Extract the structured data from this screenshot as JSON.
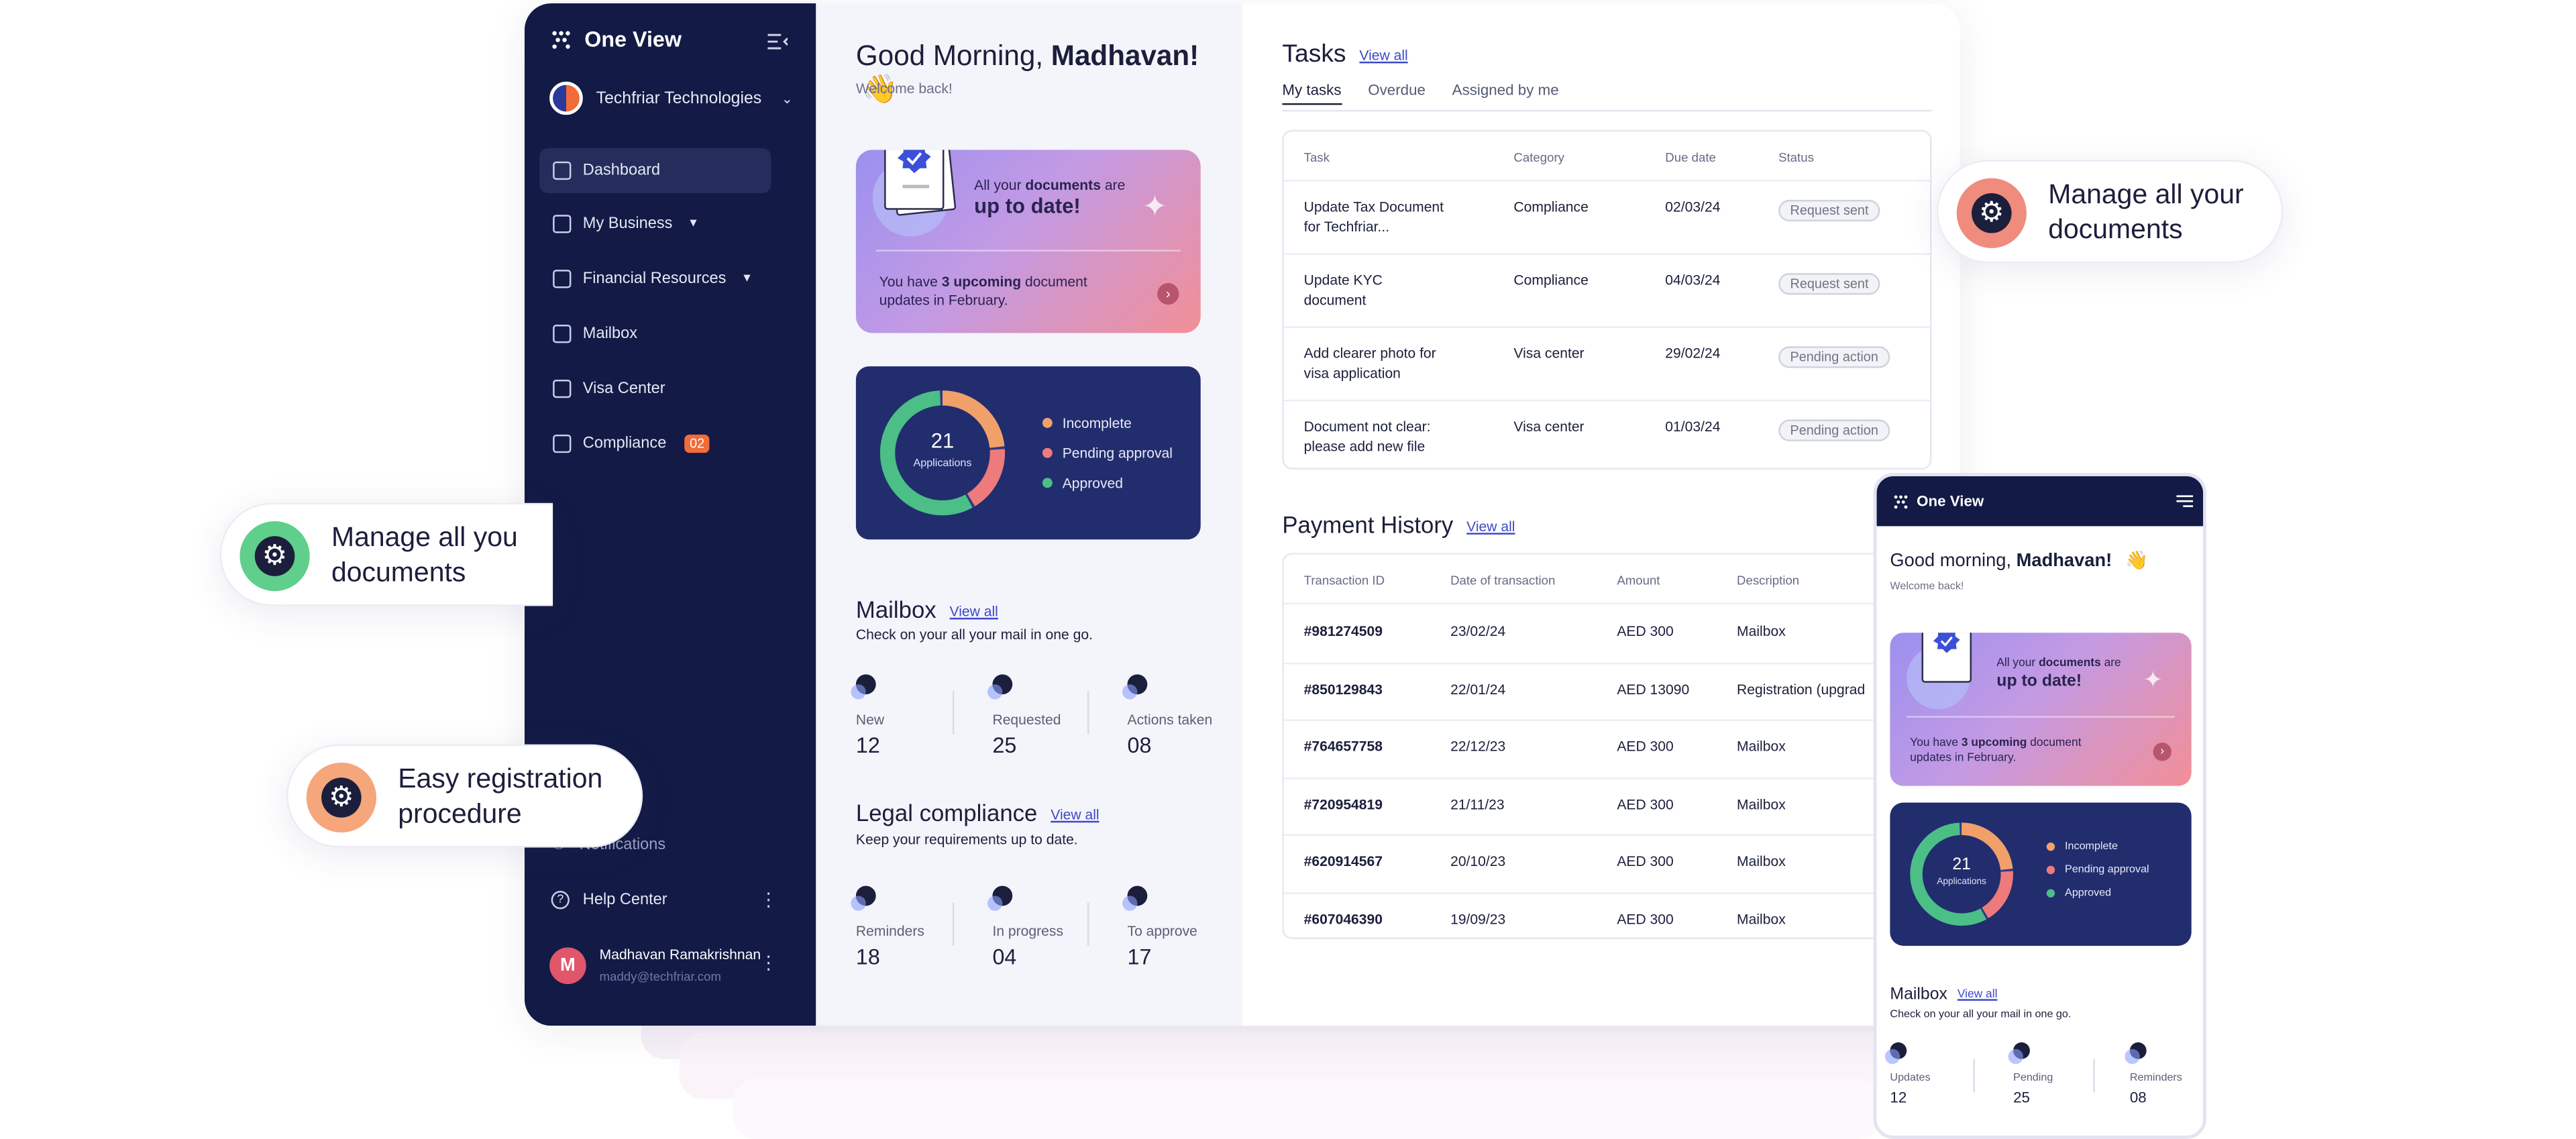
{
  "brand": {
    "name": "One View"
  },
  "org": {
    "name": "Techfriar Technologies"
  },
  "sidebar": {
    "items": [
      {
        "label": "Dashboard"
      },
      {
        "label": "My Business"
      },
      {
        "label": "Financial Resources"
      },
      {
        "label": "Mailbox"
      },
      {
        "label": "Visa Center"
      },
      {
        "label": "Compliance",
        "badge": "02"
      }
    ],
    "notifications": "Notifications",
    "help": "Help Center",
    "user": {
      "name": "Madhavan Ramakrishnan",
      "email": "maddy@techfriar.com",
      "initial": "M"
    }
  },
  "greeting": {
    "prefix": "Good Morning, ",
    "name": "Madhavan!",
    "emoji": "👋",
    "sub": "Welcome back!"
  },
  "doc_card": {
    "line1_a": "All your ",
    "line1_b": "documents",
    "line1_c": " are",
    "line2": "up to date!",
    "foot_a": "You have ",
    "foot_b": "3 upcoming",
    "foot_c": " document",
    "foot_d": "updates in February."
  },
  "applications": {
    "total": "21",
    "label": "Applications",
    "legend": [
      "Incomplete",
      "Pending approval",
      "Approved"
    ],
    "segments": [
      {
        "name": "Incomplete",
        "value": 0.24,
        "color": "#f2a06a"
      },
      {
        "name": "Pending approval",
        "value": 0.18,
        "color": "#ee7b7b"
      },
      {
        "name": "Approved",
        "value": 0.58,
        "color": "#4bbf86"
      }
    ]
  },
  "mailbox": {
    "title": "Mailbox",
    "view_all": "View all",
    "sub": "Check on your all your mail in one go.",
    "stats": [
      {
        "label": "New",
        "value": "12"
      },
      {
        "label": "Requested",
        "value": "25"
      },
      {
        "label": "Actions taken",
        "value": "08"
      }
    ]
  },
  "legal": {
    "title": "Legal compliance",
    "view_all": "View all",
    "sub": "Keep your requirements up to date.",
    "stats": [
      {
        "label": "Reminders",
        "value": "18"
      },
      {
        "label": "In progress",
        "value": "04"
      },
      {
        "label": "To approve",
        "value": "17"
      }
    ]
  },
  "tasks": {
    "title": "Tasks",
    "view_all": "View all",
    "tabs": [
      "My tasks",
      "Overdue",
      "Assigned by me"
    ],
    "headers": [
      "Task",
      "Category",
      "Due date",
      "Status"
    ],
    "rows": [
      {
        "task1": "Update Tax Document",
        "task2": "for Techfriar...",
        "category": "Compliance",
        "due": "02/03/24",
        "status": "Request sent"
      },
      {
        "task1": "Update KYC",
        "task2": "document",
        "category": "Compliance",
        "due": "04/03/24",
        "status": "Request sent"
      },
      {
        "task1": "Add clearer photo for",
        "task2": "visa application",
        "category": "Visa center",
        "due": "29/02/24",
        "status": "Pending action"
      },
      {
        "task1": "Document not clear:",
        "task2": "please add new file",
        "category": "Visa center",
        "due": "01/03/24",
        "status": "Pending action"
      }
    ]
  },
  "payments": {
    "title": "Payment History",
    "view_all": "View all",
    "headers": [
      "Transaction ID",
      "Date of transaction",
      "Amount",
      "Description"
    ],
    "rows": [
      {
        "id": "#981274509",
        "date": "23/02/24",
        "amount": "AED 300",
        "desc": "Mailbox"
      },
      {
        "id": "#850129843",
        "date": "22/01/24",
        "amount": "AED 13090",
        "desc": "Registration (upgrad"
      },
      {
        "id": "#764657758",
        "date": "22/12/23",
        "amount": "AED 300",
        "desc": "Mailbox"
      },
      {
        "id": "#720954819",
        "date": "21/11/23",
        "amount": "AED 300",
        "desc": "Mailbox"
      },
      {
        "id": "#620914567",
        "date": "20/10/23",
        "amount": "AED 300",
        "desc": "Mailbox"
      },
      {
        "id": "#607046390",
        "date": "19/09/23",
        "amount": "AED 300",
        "desc": "Mailbox"
      }
    ]
  },
  "floats": {
    "manage_left_1": "Manage all you",
    "manage_left_2": "documents",
    "easy_1": "Easy registration",
    "easy_2": "procedure",
    "manage_right_1": "Manage all your",
    "manage_right_2": "documents"
  },
  "phone": {
    "brand": "One View",
    "greet_prefix": "Good morning, ",
    "greet_name": "Madhavan!",
    "emoji": "👋",
    "sub": "Welcome back!",
    "mailbox_title": "Mailbox",
    "view_all": "View all",
    "mailbox_sub": "Check on your all your mail in one go.",
    "stats": [
      {
        "label": "Updates",
        "value": "12"
      },
      {
        "label": "Pending",
        "value": "25"
      },
      {
        "label": "Reminders",
        "value": "08"
      }
    ]
  },
  "colors": {
    "sidebar": "#121a45",
    "accent": "#3c48c9",
    "badge": "#f26b3a"
  }
}
